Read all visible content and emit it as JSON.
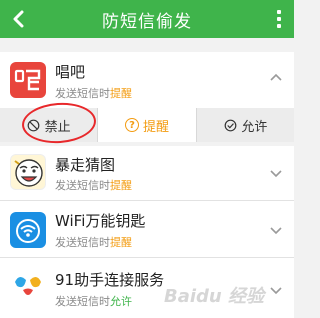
{
  "header": {
    "title": "防短信偷发",
    "back_icon": "back-arrow-icon",
    "menu_icon": "more-vert-icon",
    "color": "#3fb44b"
  },
  "apps": [
    {
      "name": "唱吧",
      "status_prefix": "发送短信时",
      "mode": "提醒",
      "icon": "changba-app-icon",
      "expanded": true
    },
    {
      "name": "暴走猜图",
      "status_prefix": "发送短信时",
      "mode": "提醒",
      "icon": "baozou-app-icon",
      "expanded": false
    },
    {
      "name": "WiFi万能钥匙",
      "status_prefix": "发送短信时",
      "mode": "提醒",
      "icon": "wifi-key-app-icon",
      "expanded": false
    },
    {
      "name": "91助手连接服务",
      "status_prefix": "发送短信时",
      "mode": "允许",
      "icon": "91-assistant-app-icon",
      "expanded": false
    }
  ],
  "actions": {
    "block": "禁止",
    "remind": "提醒",
    "allow": "允许",
    "selected": "remind"
  },
  "colors": {
    "accent": "#3fb44b",
    "remind": "#f39c12",
    "annotation": "#e8282b"
  },
  "watermark": "Baidu 经验"
}
